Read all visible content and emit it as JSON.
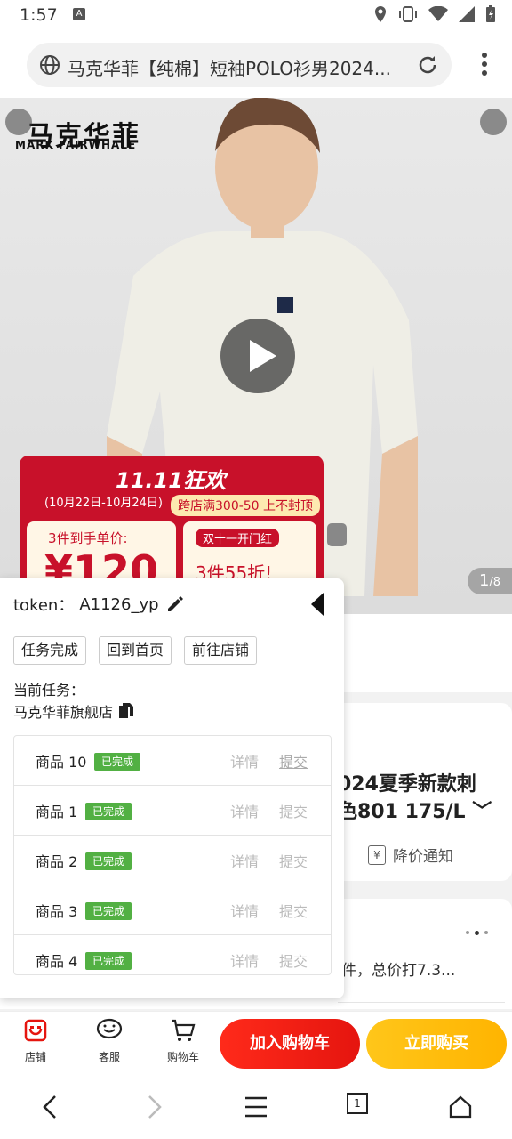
{
  "status": {
    "time": "1:57"
  },
  "browser": {
    "tab_title": "马克华菲【纯棉】短袖POLO衫男2024...",
    "icons": [
      "globe-icon",
      "reload-icon",
      "kebab-menu-icon"
    ]
  },
  "hero": {
    "brand_cn": "马克华菲",
    "brand_en": "MARK FAIRWHALE",
    "promo_title": "11.11狂欢",
    "promo_dates": "(10月22日-10月24日)",
    "promo_tag": "跨店满300-50 上不封顶",
    "promo_left_label": "3件到手单价:",
    "promo_price": "¥120",
    "promo_right_label": "双十一开门红",
    "promo_right_sub": "3件55折!",
    "image_index": "1",
    "image_total": "/8"
  },
  "behind": {
    "title_line1": "024夏季新款刺",
    "title_line2": "色801 175/L ﹀",
    "price_notice": "降价通知",
    "promo_line": "件，总价打7.3..."
  },
  "panel": {
    "token_label": "token：",
    "token_value": "A1126_yp",
    "buttons": [
      "任务完成",
      "回到首页",
      "前往店铺"
    ],
    "task_label": "当前任务：",
    "task_value": "马克华菲旗舰店",
    "rows": [
      {
        "name": "商品 10",
        "status": "已完成",
        "detail": "详情",
        "submit": "提交"
      },
      {
        "name": "商品 1",
        "status": "已完成",
        "detail": "详情",
        "submit": "提交"
      },
      {
        "name": "商品 2",
        "status": "已完成",
        "detail": "详情",
        "submit": "提交"
      },
      {
        "name": "商品 3",
        "status": "已完成",
        "detail": "详情",
        "submit": "提交"
      },
      {
        "name": "商品 4",
        "status": "已完成",
        "detail": "详情",
        "submit": "提交"
      }
    ]
  },
  "actionbar": {
    "shop": "店铺",
    "service": "客服",
    "cart": "购物车",
    "add_to_cart": "加入购物车",
    "buy_now": "立即购买"
  },
  "navbar": {
    "tab_count": "1"
  },
  "colors": {
    "accent_red": "#e5150f",
    "accent_yellow": "#ffb400",
    "done_green": "#52b043"
  }
}
